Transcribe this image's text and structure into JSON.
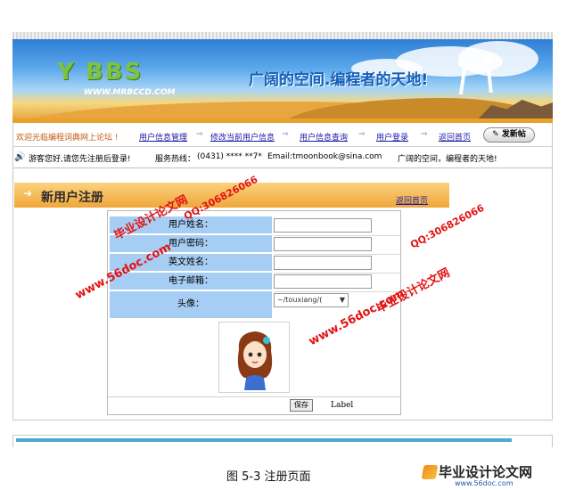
{
  "banner": {
    "logo": "Y BBS",
    "logo_url": "WWW.MRBCCD.COM",
    "slogan": "广阔的空间.编程者的天地!"
  },
  "nav": {
    "welcome": "欢迎光临编程词典网上论坛 !",
    "items": [
      "用户信息管理",
      "修改当前用户信息",
      "用户信息查询",
      "用户登录",
      "返回首页"
    ],
    "post_button": "发新帖"
  },
  "infobar": {
    "guest": "游客您好,请您先注册后登录!",
    "hotline_label": "服务热线：",
    "hotline": "(0431) **** **7*",
    "email": "Email:tmoonbook@sina.com",
    "motto": "广阔的空间，编程者的天地!"
  },
  "register": {
    "title": "新用户注册",
    "back_link": "返回首页",
    "fields": [
      {
        "label": "用户姓名：",
        "value": ""
      },
      {
        "label": "用户密码：",
        "value": ""
      },
      {
        "label": "英文姓名：",
        "value": ""
      },
      {
        "label": "电子邮箱：",
        "value": ""
      }
    ],
    "avatar_label": "头像：",
    "avatar_selected": "~/touxiang/(",
    "save_button": "保存",
    "label_text": "Label"
  },
  "watermarks": {
    "site_name": "毕业设计论文网",
    "qq": "QQ:306826066",
    "url": "www.56doc.com"
  },
  "caption": "图 5-3  注册页面",
  "corner": {
    "logo": "毕业设计论文网",
    "url": "www.56doc.com"
  }
}
